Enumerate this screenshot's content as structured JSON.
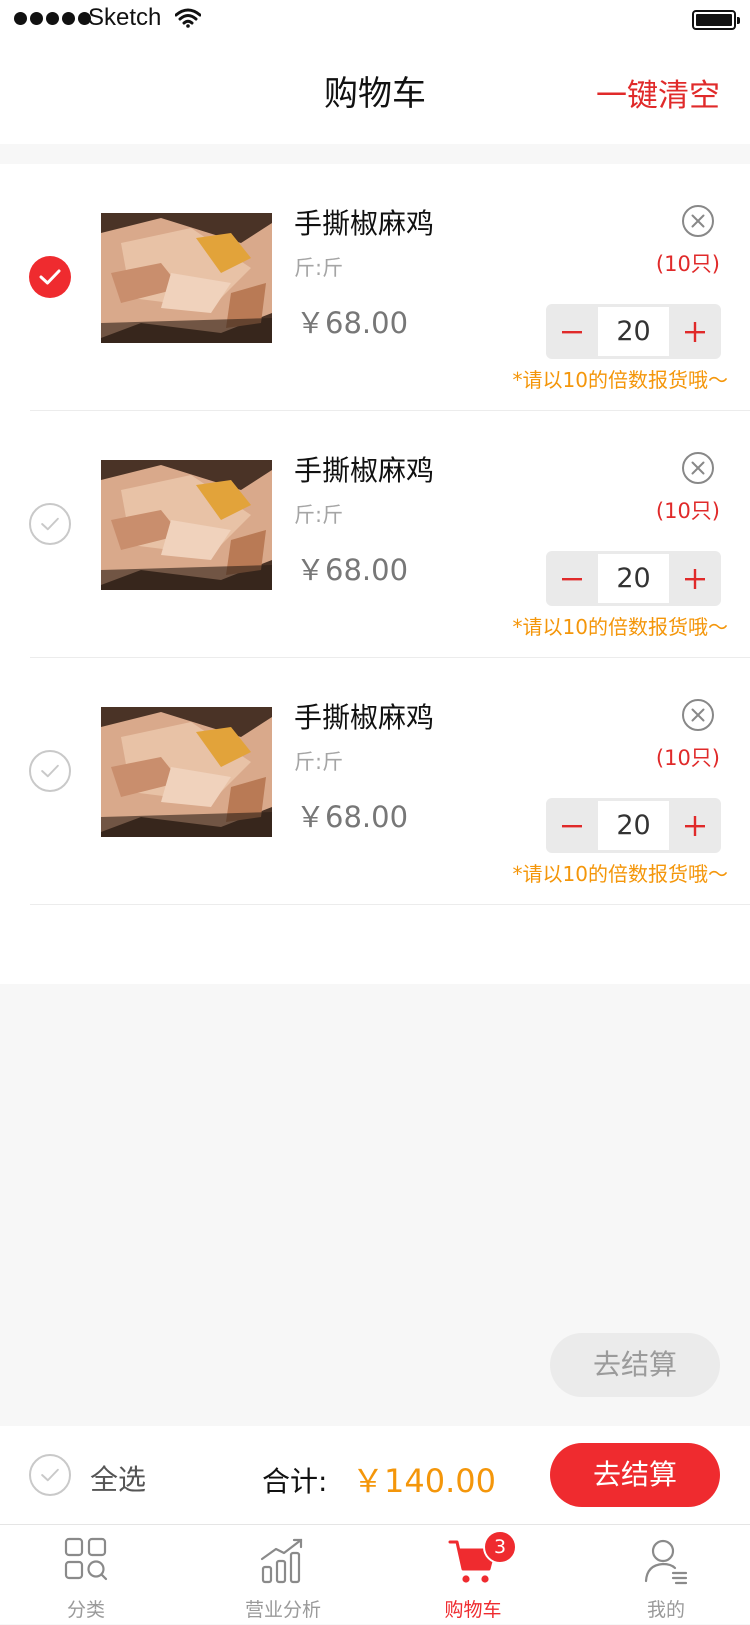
{
  "status_bar": {
    "carrier": "Sketch"
  },
  "header": {
    "title": "购物车",
    "clear_label": "一键清空"
  },
  "cart": {
    "items": [
      {
        "name": "手撕椒麻鸡",
        "spec": "斤:斤",
        "price": "￥68.00",
        "unit_note": "(10只)",
        "quantity": "20",
        "hint": "*请以10的倍数报货哦～",
        "selected": true
      },
      {
        "name": "手撕椒麻鸡",
        "spec": "斤:斤",
        "price": "￥68.00",
        "unit_note": "(10只)",
        "quantity": "20",
        "hint": "*请以10的倍数报货哦～",
        "selected": false
      },
      {
        "name": "手撕椒麻鸡",
        "spec": "斤:斤",
        "price": "￥68.00",
        "unit_note": "(10只)",
        "quantity": "20",
        "hint": "*请以10的倍数报货哦～",
        "selected": false
      }
    ]
  },
  "floating_checkout": {
    "label": "去结算"
  },
  "footer": {
    "select_all_label": "全选",
    "total_label": "合计:",
    "total_value": "￥140.00",
    "checkout_label": "去结算"
  },
  "tabbar": {
    "tabs": [
      {
        "label": "分类",
        "icon": "category-grid-icon"
      },
      {
        "label": "营业分析",
        "icon": "bar-chart-icon"
      },
      {
        "label": "购物车",
        "icon": "cart-icon",
        "badge": "3",
        "active": true
      },
      {
        "label": "我的",
        "icon": "user-profile-icon"
      }
    ]
  },
  "colors": {
    "accent": "#ef2b2f",
    "price": "#f4960a",
    "hint": "#f4960a",
    "bg": "#f7f7f7"
  }
}
